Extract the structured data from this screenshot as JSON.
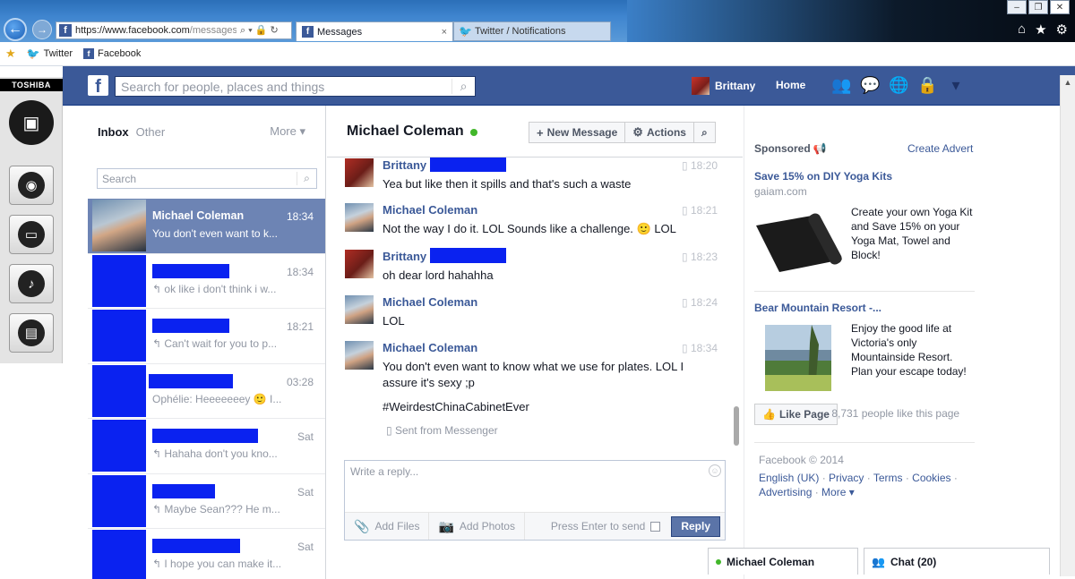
{
  "browser": {
    "url_host": "https://www.facebook.com",
    "url_path": "/messages/",
    "tabs": [
      {
        "label": "Messages",
        "icon": "facebook-icon",
        "close": "×"
      },
      {
        "label": "Twitter / Notifications",
        "icon": "twitter-icon"
      }
    ],
    "window_buttons": [
      "–",
      "❐",
      "✕"
    ],
    "favorites": [
      {
        "label": "Twitter",
        "icon": "twitter-icon"
      },
      {
        "label": "Facebook",
        "icon": "facebook-icon"
      }
    ]
  },
  "dock": {
    "brand": "TOSHIBA"
  },
  "fb": {
    "search_placeholder": "Search for people, places and things",
    "user_name": "Brittany",
    "home_label": "Home"
  },
  "threads": {
    "inbox_label": "Inbox",
    "other_label": "Other",
    "more_label": "More ▾",
    "search_placeholder": "Search",
    "items": [
      {
        "name": "Michael Coleman",
        "time": "18:34",
        "snippet": "You don't even want to k..."
      },
      {
        "name": "",
        "time": "18:34",
        "snippet": "↰ ok like i don't think i w..."
      },
      {
        "name": "",
        "time": "18:21",
        "snippet": "↰ Can't wait for you to p..."
      },
      {
        "name": "",
        "time": "03:28",
        "snippet": "Ophélie: Heeeeeeey 🙂 I..."
      },
      {
        "name": "",
        "time": "Sat",
        "snippet": "↰ Hahaha don't you kno..."
      },
      {
        "name": "",
        "time": "Sat",
        "snippet": "↰ Maybe Sean??? He m..."
      },
      {
        "name": "",
        "time": "Sat",
        "snippet": "↰ I hope you can make it..."
      }
    ]
  },
  "conversation": {
    "title": "Michael Coleman",
    "new_message": "New Message",
    "actions": "Actions",
    "messages": [
      {
        "sender": "Brittany",
        "time": "18:20",
        "text": "Yea but like then it spills and that's such a waste"
      },
      {
        "sender": "Michael Coleman",
        "time": "18:21",
        "text": "Not the way I do it. LOL Sounds like a challenge. 🙂 LOL"
      },
      {
        "sender": "Brittany",
        "time": "18:23",
        "text": "oh dear lord hahahha"
      },
      {
        "sender": "Michael Coleman",
        "time": "18:24",
        "text": "LOL"
      },
      {
        "sender": "Michael Coleman",
        "time": "18:34",
        "text": "You don't even want to know what we use for plates. LOL I assure it's sexy ;p",
        "hashtag": "#WeirdestChinaCabinetEver",
        "via": "Sent from Messenger"
      }
    ],
    "reply_placeholder": "Write a reply...",
    "add_files": "Add Files",
    "add_photos": "Add Photos",
    "press_enter": "Press Enter to send",
    "reply_button": "Reply"
  },
  "ads": {
    "sponsored": "Sponsored",
    "create_advert": "Create Advert",
    "items": [
      {
        "title": "Save 15% on DIY Yoga Kits",
        "domain": "gaiam.com",
        "text": "Create your own Yoga Kit and Save 15% on your Yoga Mat, Towel and Block!"
      },
      {
        "title": "Bear Mountain Resort -...",
        "text": "Enjoy the good life at Victoria's only Mountainside Resort. Plan your escape today!"
      }
    ],
    "like_page": "Like Page",
    "like_count": "· 8,731 people like this page",
    "footer_copyright": "Facebook © 2014",
    "footer_links": [
      "English (UK)",
      "Privacy",
      "Terms",
      "Cookies",
      "Advertising",
      "More ▾"
    ]
  },
  "chat": {
    "tab1": "Michael Coleman",
    "tab2": "Chat (20)"
  }
}
